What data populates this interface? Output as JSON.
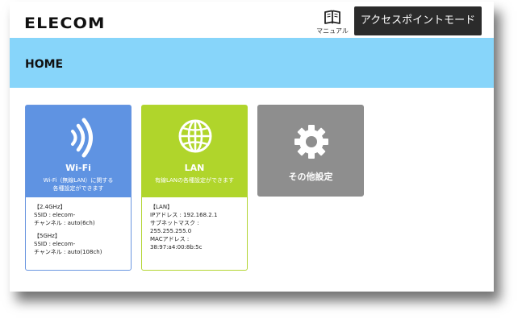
{
  "brand": {
    "logo_text": "ELECOM"
  },
  "header": {
    "manual_label": "マニュアル",
    "ap_mode_button": "アクセスポイントモード",
    "page_title": "HOME"
  },
  "cards": {
    "wifi": {
      "title": "Wi-Fi",
      "desc_line1": "Wi-Fi（無線LAN）に関する",
      "desc_line2": "各種設定ができます",
      "band24_head": "【2.4GHz】",
      "band24_ssid": "SSID : elecom-",
      "band24_channel": "チャンネル : auto(6ch)",
      "band5_head": "【5GHz】",
      "band5_ssid": "SSID : elecom-",
      "band5_channel": "チャンネル : auto(108ch)"
    },
    "lan": {
      "title": "LAN",
      "desc_line1": "有線LANの各種設定ができます",
      "info_head": "【LAN】",
      "ip": "IPアドレス : 192.168.2.1",
      "subnet_label": "サブネットマスク :",
      "subnet_value": "255.255.255.0",
      "mac_label": "MACアドレス :",
      "mac_value": "38:97:a4:00:8b:5c"
    },
    "other": {
      "title": "その他設定"
    }
  },
  "icons": {
    "manual": "book-icon",
    "wifi": "wifi-signal-icon",
    "lan": "globe-icon",
    "other": "gear-icon"
  },
  "colors": {
    "header_band": "#87d5fa",
    "wifi_card": "#5f93e2",
    "lan_card": "#b0d52b",
    "other_card": "#8e8e8e",
    "ap_button": "#2b2b2b"
  }
}
